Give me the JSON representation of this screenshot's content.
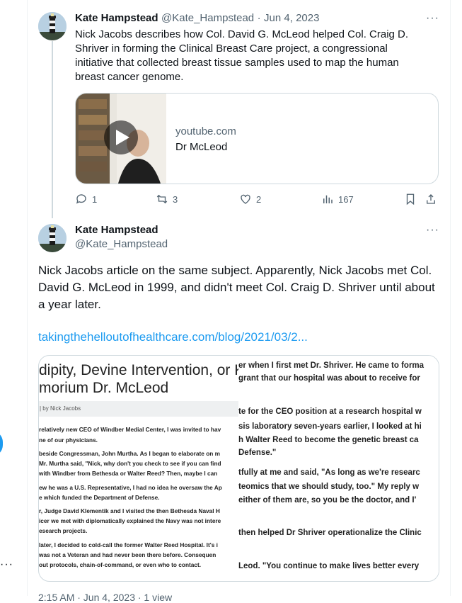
{
  "tweet1": {
    "name": "Kate Hampstead",
    "handle": "@Kate_Hampstead",
    "separator": "·",
    "date": "Jun 4, 2023",
    "text": "Nick Jacobs describes how Col. David G. McLeod helped Col. Craig D. Shriver in forming the Clinical Breast Care project, a congressional initiative that collected breast tissue samples used to map the human breast cancer genome.",
    "card": {
      "domain": "youtube.com",
      "title": "Dr McLeod"
    },
    "actions": {
      "replies": "1",
      "reposts": "3",
      "likes": "2",
      "views": "167"
    }
  },
  "tweet2": {
    "name": "Kate Hampstead",
    "handle": "@Kate_Hampstead",
    "text": "Nick Jacobs article on the same subject. Apparently, Nick Jacobs met Col. David G. McLeod in 1999, and didn't meet Col. Craig D. Shriver until about a year later.",
    "link": "takingthehelloutofhealthcare.com/blog/2021/03/2...",
    "doc_left": {
      "title_line1": "dipity, Devine Intervention, or Ka",
      "title_line2": "morium Dr. McLeod",
      "author": "| by Nick Jacobs",
      "lines": [
        "relatively new CEO of Windber Medial Center, I was invited to hav",
        "ne of our physicians.",
        "beside Congressman, John Murtha.  As I began to elaborate on m",
        "Mr. Murtha said, \"Nick, why don't you check to see if you can find",
        "with Windber from Bethesda or Walter Reed? Then, maybe I can",
        "ew he was a U.S. Representative, I had no idea he oversaw the Ap",
        "e which funded the Department of Defense.",
        "r, Judge David Klementik and I visited the then Bethesda Naval H",
        "icer we met with diplomatically explained the Navy was not intere",
        "esearch projects.",
        "later, I decided to cold-call the former Walter Reed Hospital. It's i",
        "was not a Veteran and had never been there  before.  Consequen",
        "out protocols, chain-of-command, or even who to contact."
      ]
    },
    "doc_right": {
      "lines": [
        "er when I first met Dr. Shriver. He came to forma",
        "grant that our hospital was about to receive for",
        "te for the CEO position at a research hospital w",
        "sis laboratory seven-years earlier, I looked at hi",
        "h Walter Reed to become the genetic breast ca",
        "Defense.\"",
        "tfully at me and said, \"As long as we're researc",
        "teomics that we should study, too.\"  My reply w",
        "either of them are, so you be the doctor, and I'",
        "then helped Dr Shriver operationalize the Clinic",
        "Leod. \"You continue to make lives better every"
      ]
    }
  },
  "left_more": "···",
  "more_label": "···",
  "bottom_text": "2:15 AM · Jun 4, 2023 · 1 view"
}
